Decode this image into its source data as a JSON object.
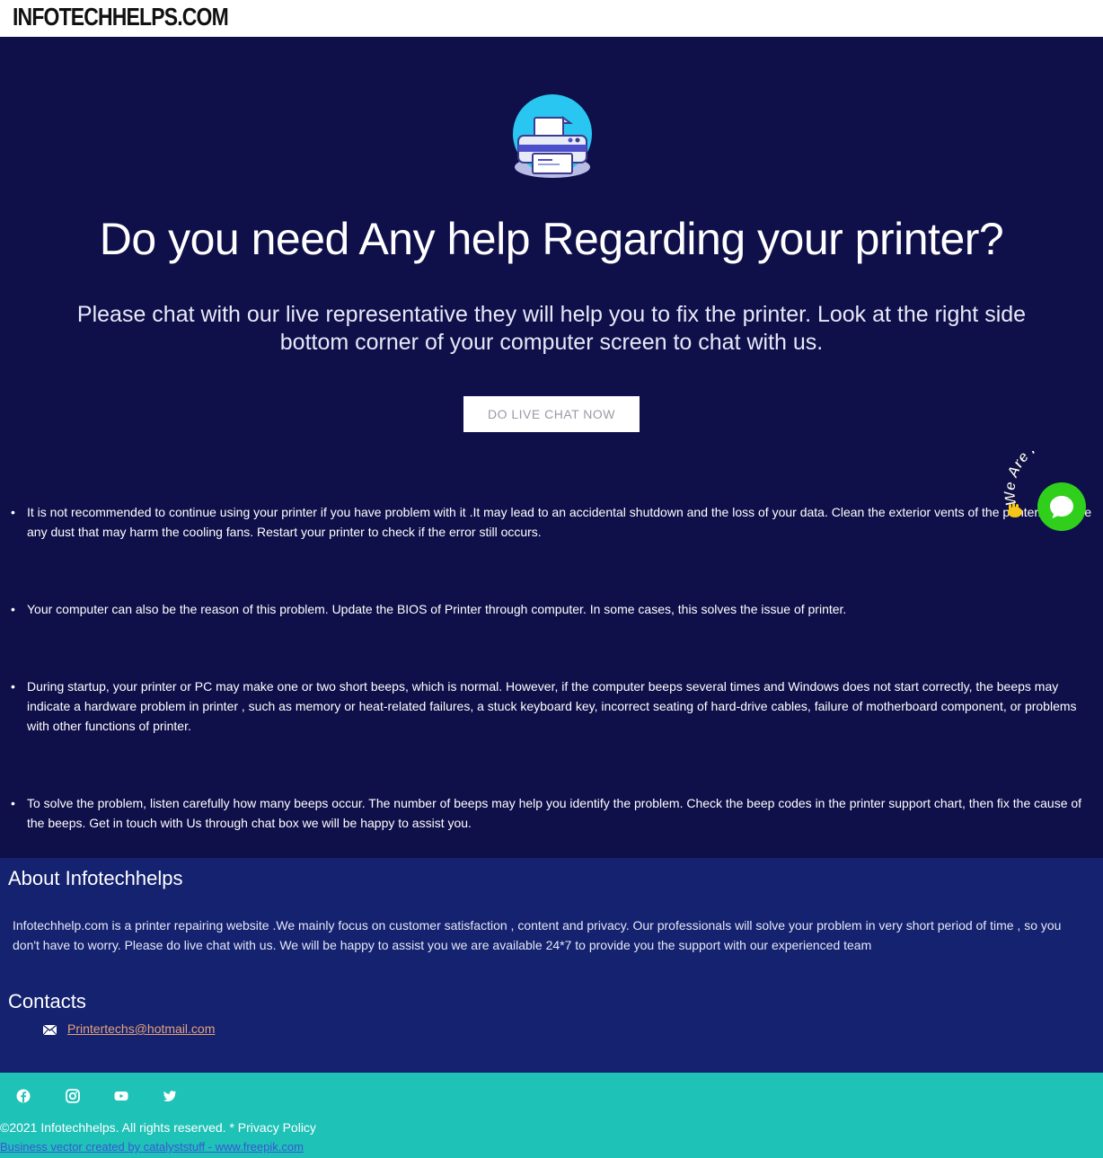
{
  "header": {
    "brand": "INFOTECHHELPS.COM"
  },
  "hero": {
    "icon": "printer-icon",
    "headline": "Do you need Any help Regarding your printer?",
    "subline": "Please chat with our live representative they will help you to fix the printer. Look at the right side bottom corner of your computer screen to chat with us.",
    "cta_label": "DO LIVE CHAT NOW"
  },
  "tips": [
    " It is not recommended to continue using your printer if you have problem with it .It may lead to an accidental shutdown and the loss of your data. Clean the exterior vents of the printer. Remove any dust that may harm the cooling fans. Restart your printer to check if the error still occurs.",
    " Your computer can also be the reason of this problem. Update the BIOS of Printer through computer. In some cases, this solves the issue of printer.",
    " During startup, your printer or PC may make one or two short beeps, which is normal. However, if the computer beeps several times and Windows does not start correctly, the beeps may indicate a hardware problem in printer , such as memory or heat-related failures, a stuck keyboard key, incorrect seating of hard-drive cables, failure of motherboard component, or problems with other functions of printer.",
    " To solve the problem, listen carefully how many beeps occur. The number of beeps may help you identify the problem. Check the beep codes in the printer support chart, then fix the cause of the beeps. Get in touch with Us through chat box we will be happy to assist you."
  ],
  "about": {
    "title": "About Infotechhelps",
    "text": "Infotechhelp.com is a printer repairing website .We mainly focus on customer satisfaction , content and privacy. Our professionals will solve your problem in very short period of time , so you don't have to worry. Please do live chat with us. We will be happy to assist you we are available 24*7 to provide you the support with our experienced team"
  },
  "contacts": {
    "title": "Contacts",
    "email_icon": "envelope-icon",
    "email": "Printertechs@hotmail.com"
  },
  "footer": {
    "social_icons": [
      "facebook-icon",
      "instagram-icon",
      "youtube-icon",
      "twitter-icon"
    ],
    "copyright": "©2021 Infotechhelps. All rights reserved.  * Privacy Policy",
    "credit": "Business vector created by catalyststuff - www.freepik.com"
  },
  "chat_widget": {
    "badge_text": "We Are Here!",
    "icon": "chat-bubble-icon",
    "wave_icon": "waving-hand-icon"
  },
  "colors": {
    "hero_bg": "#0f0f4a",
    "about_bg": "#14226f",
    "footer_bg": "#1fc2b7",
    "chat_green": "#2fcf1b",
    "link": "#e6a27a"
  }
}
